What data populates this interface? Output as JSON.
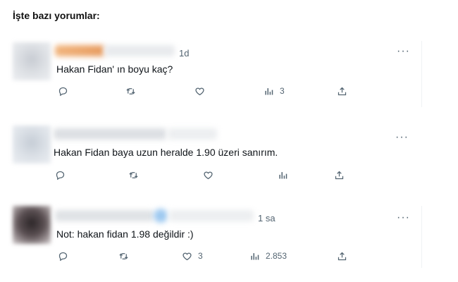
{
  "heading": "İşte bazı yorumlar:",
  "tweets": [
    {
      "time": "1d",
      "text": "Hakan Fidan' ın boyu kaç?",
      "replies": "",
      "retweets": "",
      "likes": "",
      "views": "3"
    },
    {
      "time": "",
      "text": "Hakan Fidan baya uzun heralde 1.90 üzeri sanırım.",
      "replies": "",
      "retweets": "",
      "likes": "",
      "views": ""
    },
    {
      "time": "1 sa",
      "text": "Not: hakan fidan 1.98 değildir :)",
      "replies": "",
      "retweets": "",
      "likes": "3",
      "views": "2.853"
    }
  ],
  "icons": {
    "reply": "reply-icon",
    "retweet": "retweet-icon",
    "like": "heart-icon",
    "views": "views-icon",
    "share": "share-icon",
    "more": "more-icon"
  },
  "colors": {
    "icon": "#536471",
    "text": "#0f1419",
    "divider": "#eff3f4"
  }
}
